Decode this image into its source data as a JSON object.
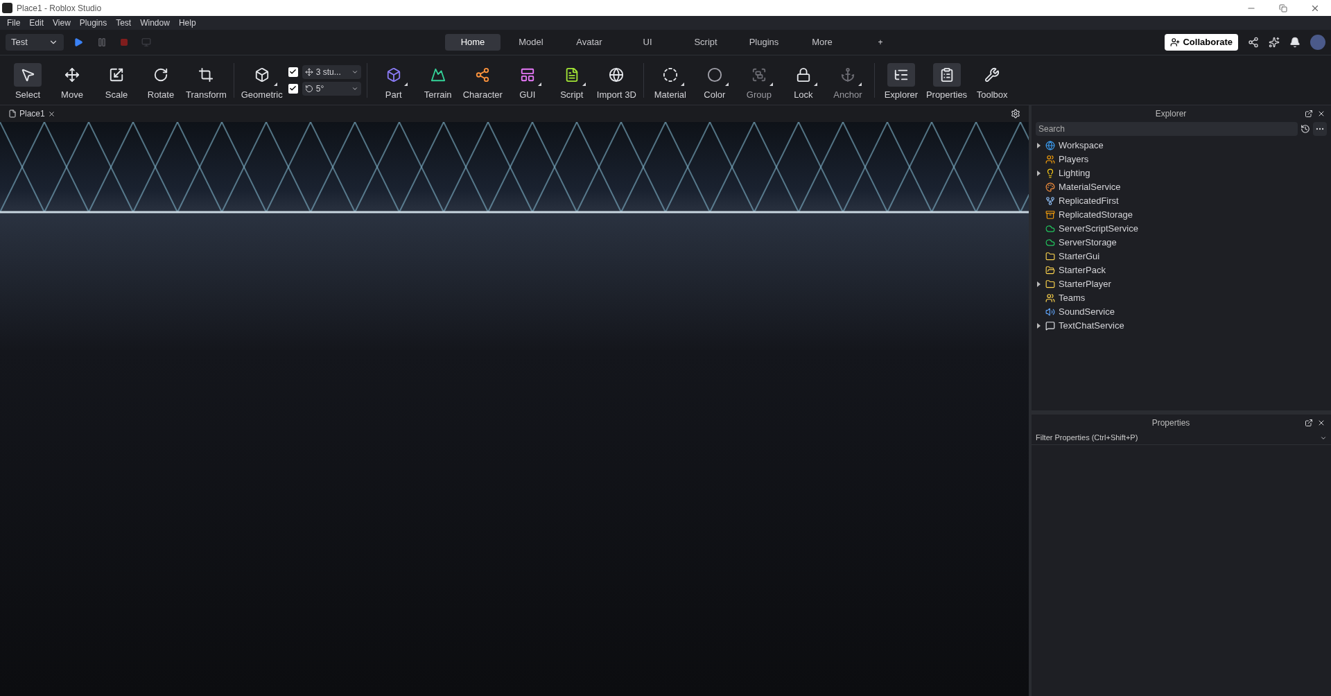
{
  "window": {
    "title": "Place1 - Roblox Studio"
  },
  "menu": [
    "File",
    "Edit",
    "View",
    "Plugins",
    "Test",
    "Window",
    "Help"
  ],
  "mode_dropdown": {
    "value": "Test"
  },
  "tabs": [
    {
      "label": "Home",
      "selected": true
    },
    {
      "label": "Model",
      "selected": false
    },
    {
      "label": "Avatar",
      "selected": false
    },
    {
      "label": "UI",
      "selected": false
    },
    {
      "label": "Script",
      "selected": false
    },
    {
      "label": "Plugins",
      "selected": false
    },
    {
      "label": "More",
      "selected": false
    }
  ],
  "add_tab": "+",
  "collaborate": "Collaborate",
  "ribbon": [
    [
      {
        "label": "Select",
        "selected": true,
        "has_menu": false,
        "disabled": false
      },
      {
        "label": "Move",
        "selected": false,
        "has_menu": false,
        "disabled": false
      },
      {
        "label": "Scale",
        "selected": false,
        "has_menu": false,
        "disabled": false
      },
      {
        "label": "Rotate",
        "selected": false,
        "has_menu": false,
        "disabled": false
      },
      {
        "label": "Transform",
        "selected": false,
        "has_menu": false,
        "disabled": false
      }
    ],
    [
      {
        "label": "Geometric",
        "selected": false,
        "has_menu": true,
        "disabled": false
      }
    ],
    [
      {
        "label": "Part",
        "selected": false,
        "has_menu": true,
        "disabled": false
      },
      {
        "label": "Terrain",
        "selected": false,
        "has_menu": false,
        "disabled": false
      },
      {
        "label": "Character",
        "selected": false,
        "has_menu": false,
        "disabled": false
      },
      {
        "label": "GUI",
        "selected": false,
        "has_menu": true,
        "disabled": false
      },
      {
        "label": "Script",
        "selected": false,
        "has_menu": true,
        "disabled": false
      },
      {
        "label": "Import 3D",
        "selected": false,
        "has_menu": false,
        "disabled": false
      }
    ],
    [
      {
        "label": "Material",
        "selected": false,
        "has_menu": true,
        "disabled": false
      },
      {
        "label": "Color",
        "selected": false,
        "has_menu": true,
        "disabled": false
      },
      {
        "label": "Group",
        "selected": false,
        "has_menu": true,
        "disabled": true
      },
      {
        "label": "Lock",
        "selected": false,
        "has_menu": true,
        "disabled": false
      },
      {
        "label": "Anchor",
        "selected": false,
        "has_menu": true,
        "disabled": true
      }
    ],
    [
      {
        "label": "Explorer",
        "selected": true,
        "has_menu": false,
        "disabled": false
      },
      {
        "label": "Properties",
        "selected": true,
        "has_menu": false,
        "disabled": false
      },
      {
        "label": "Toolbox",
        "selected": false,
        "has_menu": false,
        "disabled": false
      }
    ]
  ],
  "snap": [
    {
      "kind": "move",
      "value": "3 stu...",
      "checked": true
    },
    {
      "kind": "rotate",
      "value": "5°",
      "checked": true
    }
  ],
  "document_tab": {
    "label": "Place1"
  },
  "explorer": {
    "title": "Explorer",
    "search_placeholder": "Search",
    "items": [
      {
        "label": "Workspace",
        "expandable": true
      },
      {
        "label": "Players",
        "expandable": false
      },
      {
        "label": "Lighting",
        "expandable": true
      },
      {
        "label": "MaterialService",
        "expandable": false
      },
      {
        "label": "ReplicatedFirst",
        "expandable": false
      },
      {
        "label": "ReplicatedStorage",
        "expandable": false
      },
      {
        "label": "ServerScriptService",
        "expandable": false
      },
      {
        "label": "ServerStorage",
        "expandable": false
      },
      {
        "label": "StarterGui",
        "expandable": false
      },
      {
        "label": "StarterPack",
        "expandable": false
      },
      {
        "label": "StarterPlayer",
        "expandable": true
      },
      {
        "label": "Teams",
        "expandable": false
      },
      {
        "label": "SoundService",
        "expandable": false
      },
      {
        "label": "TextChatService",
        "expandable": true
      }
    ]
  },
  "properties": {
    "title": "Properties",
    "filter_placeholder": "Filter Properties (Ctrl+Shift+P)"
  }
}
